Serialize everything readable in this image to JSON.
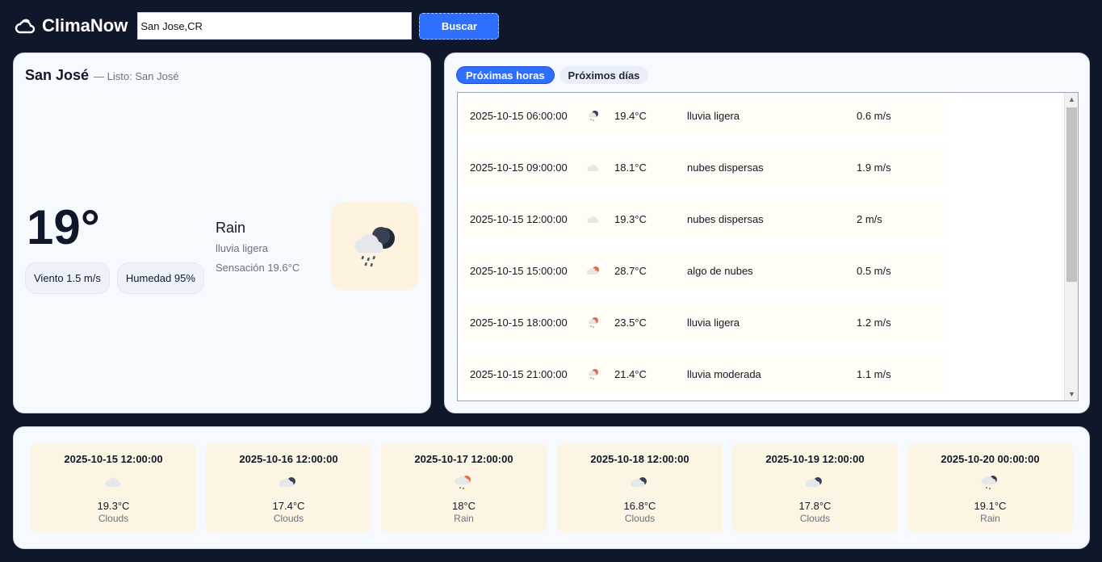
{
  "app": {
    "title": "ClimaNow",
    "logo_icon": "cloud-icon"
  },
  "search": {
    "value": "San Jose,CR",
    "button_label": "Buscar"
  },
  "current": {
    "city": "San José",
    "status": "— Listo: San José",
    "temp": "19°",
    "wind": "Viento 1.5 m/s",
    "humidity": "Humedad 95%",
    "condition": "Rain",
    "description": "lluvia ligera",
    "feels_like": "Sensación 19.6°C",
    "icon": "rain-night-icon",
    "icon_bg": "#fdf3de"
  },
  "tabs": [
    {
      "label": "Próximas horas",
      "active": true
    },
    {
      "label": "Próximos días",
      "active": false
    }
  ],
  "hourly": [
    {
      "time": "2025-10-15 06:00:00",
      "icon": "rain-night-icon",
      "temp": "19.4°C",
      "desc": "lluvia ligera",
      "wind": "0.6 m/s"
    },
    {
      "time": "2025-10-15 09:00:00",
      "icon": "cloud-icon",
      "temp": "18.1°C",
      "desc": "nubes dispersas",
      "wind": "1.9 m/s"
    },
    {
      "time": "2025-10-15 12:00:00",
      "icon": "cloud-icon",
      "temp": "19.3°C",
      "desc": "nubes dispersas",
      "wind": "2 m/s"
    },
    {
      "time": "2025-10-15 15:00:00",
      "icon": "sun-cloud-icon",
      "temp": "28.7°C",
      "desc": "algo de nubes",
      "wind": "0.5 m/s"
    },
    {
      "time": "2025-10-15 18:00:00",
      "icon": "rain-sun-icon",
      "temp": "23.5°C",
      "desc": "lluvia ligera",
      "wind": "1.2 m/s"
    },
    {
      "time": "2025-10-15 21:00:00",
      "icon": "rain-sun-icon",
      "temp": "21.4°C",
      "desc": "lluvia moderada",
      "wind": "1.1 m/s"
    }
  ],
  "daily": [
    {
      "date": "2025-10-15 12:00:00",
      "icon": "cloud-icon",
      "temp": "19.3°C",
      "cond": "Clouds"
    },
    {
      "date": "2025-10-16 12:00:00",
      "icon": "cloud-night-icon",
      "temp": "17.4°C",
      "cond": "Clouds"
    },
    {
      "date": "2025-10-17 12:00:00",
      "icon": "rain-sun-icon",
      "temp": "18°C",
      "cond": "Rain"
    },
    {
      "date": "2025-10-18 12:00:00",
      "icon": "cloud-night-icon",
      "temp": "16.8°C",
      "cond": "Clouds"
    },
    {
      "date": "2025-10-19 12:00:00",
      "icon": "cloud-night-icon",
      "temp": "17.8°C",
      "cond": "Clouds"
    },
    {
      "date": "2025-10-20 00:00:00",
      "icon": "rain-night-icon",
      "temp": "19.1°C",
      "cond": "Rain"
    }
  ],
  "colors": {
    "background": "#0f172a",
    "accent": "#2f6fff",
    "panel": "#f6f9fe",
    "card": "#fdf5e4"
  }
}
